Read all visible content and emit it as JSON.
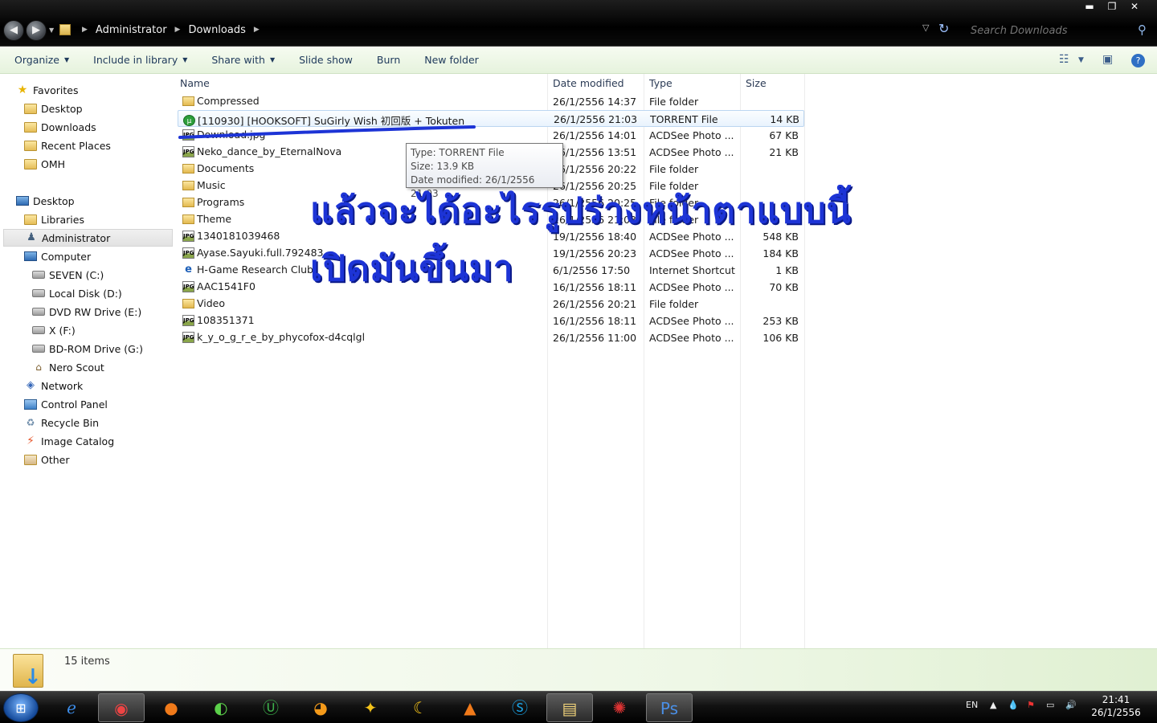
{
  "window": {
    "minimize": "▬",
    "maximize": "❐",
    "close": "✕"
  },
  "address": {
    "crumbs": [
      "Administrator",
      "Downloads"
    ],
    "search_placeholder": "Search Downloads"
  },
  "toolbar": {
    "organize": "Organize",
    "include_in_library": "Include in library",
    "share_with": "Share with",
    "slide_show": "Slide show",
    "burn": "Burn",
    "new_folder": "New folder"
  },
  "nav": {
    "favorites": "Favorites",
    "fav_items": [
      "Desktop",
      "Downloads",
      "Recent Places",
      "OMH"
    ],
    "desktop": "Desktop",
    "libraries": "Libraries",
    "administrator": "Administrator",
    "computer": "Computer",
    "drives": [
      "SEVEN (C:)",
      "Local Disk (D:)",
      "DVD RW Drive (E:)",
      "X (F:)",
      "BD-ROM Drive (G:)",
      "Nero Scout"
    ],
    "network": "Network",
    "control_panel": "Control Panel",
    "recycle_bin": "Recycle Bin",
    "image_catalog": "Image Catalog",
    "other": "Other"
  },
  "columns": {
    "name": "Name",
    "date": "Date modified",
    "type": "Type",
    "size": "Size"
  },
  "files": [
    {
      "name": "Compressed",
      "date": "26/1/2556 14:37",
      "type": "File folder",
      "size": "",
      "icon": "folder"
    },
    {
      "name": "[110930] [HOOKSOFT] SuGirly Wish 初回版 + Tokuten",
      "date": "26/1/2556 21:03",
      "type": "TORRENT File",
      "size": "14 KB",
      "icon": "torrent"
    },
    {
      "name": "Download.jpg",
      "date": "26/1/2556 14:01",
      "type": "ACDSee Photo ...",
      "size": "67 KB",
      "icon": "jpg"
    },
    {
      "name": "Neko_dance_by_EternalNova",
      "date": "26/1/2556 13:51",
      "type": "ACDSee Photo ...",
      "size": "21 KB",
      "icon": "jpg"
    },
    {
      "name": "Documents",
      "date": "26/1/2556 20:22",
      "type": "File folder",
      "size": "",
      "icon": "folder"
    },
    {
      "name": "Music",
      "date": "26/1/2556 20:25",
      "type": "File folder",
      "size": "",
      "icon": "folder"
    },
    {
      "name": "Programs",
      "date": "26/1/2556 20:25",
      "type": "File folder",
      "size": "",
      "icon": "folder"
    },
    {
      "name": "Theme",
      "date": "26/1/2556 21:03",
      "type": "File folder",
      "size": "",
      "icon": "folder"
    },
    {
      "name": "1340181039468",
      "date": "19/1/2556 18:40",
      "type": "ACDSee Photo ...",
      "size": "548 KB",
      "icon": "jpg"
    },
    {
      "name": "Ayase.Sayuki.full.792483",
      "date": "19/1/2556 20:23",
      "type": "ACDSee Photo ...",
      "size": "184 KB",
      "icon": "jpg"
    },
    {
      "name": "H-Game Research Club",
      "date": "6/1/2556 17:50",
      "type": "Internet Shortcut",
      "size": "1 KB",
      "icon": "url"
    },
    {
      "name": "AAC1541F0",
      "date": "16/1/2556 18:11",
      "type": "ACDSee Photo ...",
      "size": "70 KB",
      "icon": "jpg"
    },
    {
      "name": "Video",
      "date": "26/1/2556 20:21",
      "type": "File folder",
      "size": "",
      "icon": "folder"
    },
    {
      "name": "108351371",
      "date": "16/1/2556 18:11",
      "type": "ACDSee Photo ...",
      "size": "253 KB",
      "icon": "jpg"
    },
    {
      "name": "k_y_o_g_r_e_by_phycofox-d4cqlgl",
      "date": "26/1/2556 11:00",
      "type": "ACDSee Photo ...",
      "size": "106 KB",
      "icon": "jpg"
    }
  ],
  "tooltip": {
    "type": "Type: TORRENT File",
    "size": "Size: 13.9 KB",
    "date": "Date modified: 26/1/2556 21:03"
  },
  "overlay": {
    "line1": "แล้วจะได้อะไรรูปร่างหน้าตาแบบนี้",
    "line2": "เปิดมันขึ้นมา"
  },
  "details": {
    "count": "15 items"
  },
  "taskbar": {
    "language": "EN",
    "time": "21:41",
    "date": "26/1/2556"
  },
  "colors": {
    "annotation": "#1d34d6",
    "toolbar_text": "#1e395b",
    "selection": "#bcd6f1"
  }
}
